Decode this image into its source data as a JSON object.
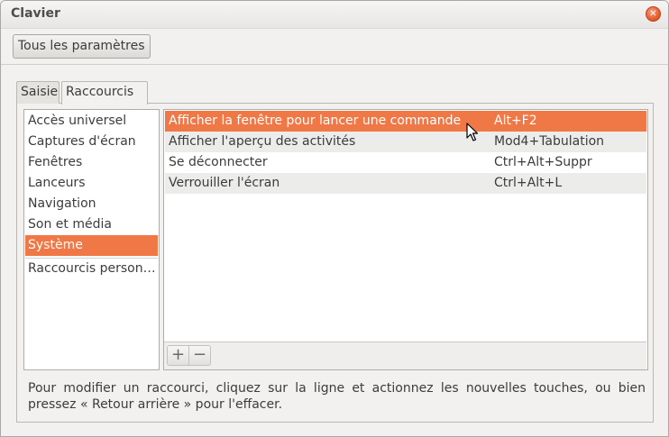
{
  "window": {
    "title": "Clavier"
  },
  "toolbar": {
    "all_settings_label": "Tous les paramètres"
  },
  "tabs": [
    {
      "label": "Saisie",
      "active": false
    },
    {
      "label": "Raccourcis",
      "active": true
    }
  ],
  "categories": [
    "Accès universel",
    "Captures d'écran",
    "Fenêtres",
    "Lanceurs",
    "Navigation",
    "Son et média",
    "Système",
    "Raccourcis person…"
  ],
  "selected_category": "Système",
  "shortcuts": [
    {
      "name": "Afficher la fenêtre pour lancer une commande",
      "keys": "Alt+F2",
      "selected": true
    },
    {
      "name": "Afficher l'aperçu des activités",
      "keys": "Mod4+Tabulation",
      "selected": false
    },
    {
      "name": "Se déconnecter",
      "keys": "Ctrl+Alt+Suppr",
      "selected": false
    },
    {
      "name": "Verrouiller l'écran",
      "keys": "Ctrl+Alt+L",
      "selected": false
    }
  ],
  "list_buttons": {
    "add": "+",
    "remove": "−"
  },
  "help_text": "Pour modifier un raccourci, cliquez sur la ligne et actionnez les nouvelles touches, ou bien pressez « Retour arrière » pour l'effacer.",
  "colors": {
    "accent": "#f07746",
    "close": "#e95d2d"
  }
}
